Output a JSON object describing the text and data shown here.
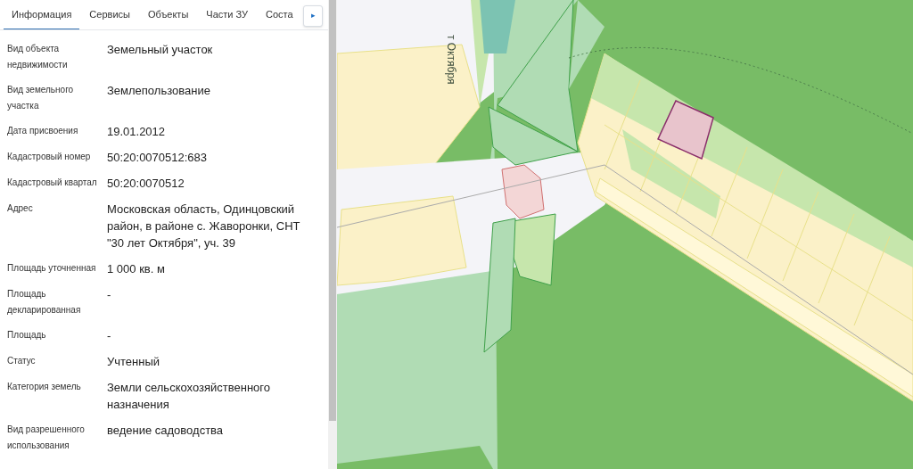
{
  "tabs": [
    {
      "label": "Информация",
      "selected": true
    },
    {
      "label": "Сервисы",
      "selected": false
    },
    {
      "label": "Объекты",
      "selected": false
    },
    {
      "label": "Части ЗУ",
      "selected": false
    },
    {
      "label": "Соста",
      "selected": false
    }
  ],
  "tab_scroll_button": {
    "label": "▸"
  },
  "properties": [
    {
      "label": "Вид объекта недвижимости",
      "value": "Земельный участок"
    },
    {
      "label": "Вид земельного участка",
      "value": "Землепользование"
    },
    {
      "label": "Дата присвоения",
      "value": "19.01.2012"
    },
    {
      "label": "Кадастровый номер",
      "value": "50:20:0070512:683"
    },
    {
      "label": "Кадастровый квартал",
      "value": "50:20:0070512"
    },
    {
      "label": "Адрес",
      "value": "Московская область, Одинцовский район, в районе с. Жаворонки, СНТ \"30 лет Октября\", уч. 39"
    },
    {
      "label": "Площадь уточненная",
      "value": "1 000 кв. м"
    },
    {
      "label": "Площадь декларированная",
      "value": "-"
    },
    {
      "label": "Площадь",
      "value": "-"
    },
    {
      "label": "Статус",
      "value": "Учтенный"
    },
    {
      "label": "Категория земель",
      "value": "Земли сельскохозяйственного назначения"
    },
    {
      "label": "Вид разрешенного использования",
      "value": "ведение садоводства"
    }
  ],
  "map": {
    "street_label": "т Октября"
  }
}
